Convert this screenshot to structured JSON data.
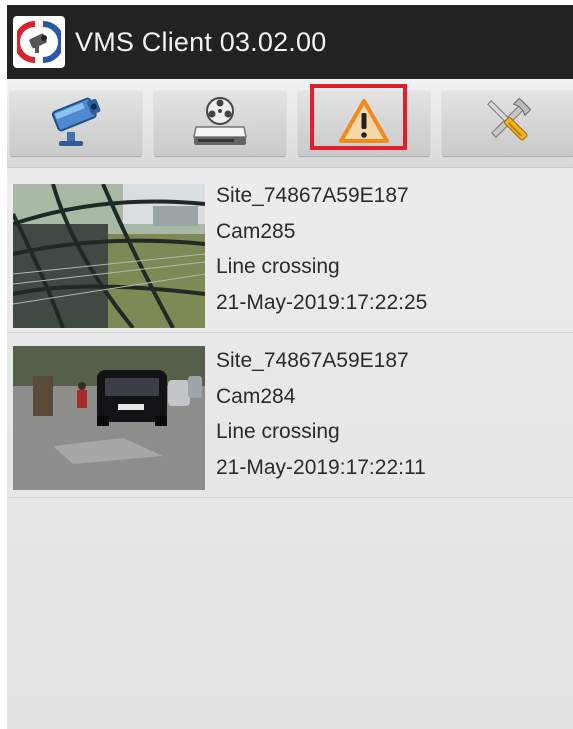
{
  "app": {
    "title": "VMS Client 03.02.00",
    "icon": "vms-logo-icon"
  },
  "toolbar": {
    "buttons": [
      {
        "icon": "camera-icon",
        "selected": false
      },
      {
        "icon": "playback-reel-icon",
        "selected": false
      },
      {
        "icon": "alert-warning-icon",
        "selected": true
      },
      {
        "icon": "tools-settings-icon",
        "selected": false
      }
    ],
    "highlight_color": "#e01f2a"
  },
  "events": [
    {
      "site": "Site_74867A59E187",
      "camera": "Cam285",
      "type": "Line crossing",
      "timestamp": "21-May-2019:17:22:25"
    },
    {
      "site": "Site_74867A59E187",
      "camera": "Cam284",
      "type": "Line crossing",
      "timestamp": "21-May-2019:17:22:11"
    }
  ]
}
